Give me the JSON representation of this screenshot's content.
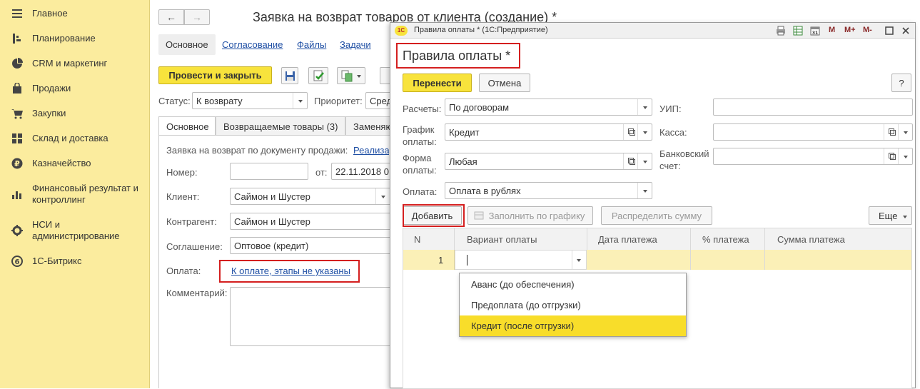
{
  "sidebar": {
    "items": [
      {
        "label": "Главное",
        "icon": "menu-icon"
      },
      {
        "label": "Планирование",
        "icon": "planning-icon"
      },
      {
        "label": "CRM и маркетинг",
        "icon": "crm-icon"
      },
      {
        "label": "Продажи",
        "icon": "bag-icon"
      },
      {
        "label": "Закупки",
        "icon": "cart-icon"
      },
      {
        "label": "Склад и доставка",
        "icon": "warehouse-icon"
      },
      {
        "label": "Казначейство",
        "icon": "ruble-icon"
      },
      {
        "label": "Финансовый результат и контроллинг",
        "icon": "bar-chart-icon"
      },
      {
        "label": "НСИ и администрирование",
        "icon": "gear-icon"
      },
      {
        "label": "1С-Битрикс",
        "icon": "bitrix-icon"
      }
    ]
  },
  "main": {
    "title": "Заявка на возврат товаров от клиента (создание) *",
    "tabs": [
      "Основное",
      "Согласование",
      "Файлы",
      "Задачи"
    ],
    "post_close_label": "Провести и закрыть",
    "status_label": "Статус:",
    "status_value": "К возврату",
    "priority_label": "Приоритет:",
    "priority_value": "Сред",
    "inner_tabs": [
      "Основное",
      "Возвращаемые товары (3)",
      "Заменяю"
    ],
    "sale_doc_label": "Заявка на возврат по документу продажи:",
    "sale_doc_link": "Реализа",
    "number_label": "Номер:",
    "number_value": "",
    "date_label": "от:",
    "date_value": "22.11.2018  0",
    "client_label": "Клиент:",
    "client_value": "Саймон и Шустер",
    "contractor_label": "Контрагент:",
    "contractor_value": "Саймон и Шустер",
    "agreement_label": "Соглашение:",
    "agreement_value": "Оптовое (кредит)",
    "payment_label": "Оплата:",
    "payment_link": "К оплате, этапы не указаны",
    "comment_label": "Комментарий:",
    "comment_value": ""
  },
  "dialog": {
    "window_title": "Правила оплаты * (1С:Предприятие)",
    "logo_text": "1С",
    "toolbar_icons": [
      "print-icon",
      "table-icon",
      "calendar-icon",
      "memory-m-icon",
      "memory-m-plus-icon",
      "memory-m-minus-icon",
      "maximize-icon",
      "close-icon"
    ],
    "toolbar_text": [
      "M",
      "M+",
      "M-"
    ],
    "heading": "Правила оплаты *",
    "transfer_label": "Перенести",
    "cancel_label": "Отмена",
    "help_label": "?",
    "settlements_label": "Расчеты:",
    "settlements_value": "По договорам",
    "uip_label": "УИП:",
    "uip_value": "",
    "schedule_label_1": "График",
    "schedule_label_2": "оплаты:",
    "schedule_value": "Кредит",
    "cashbox_label": "Касса:",
    "cashbox_value": "",
    "form_label_1": "Форма",
    "form_label_2": "оплаты:",
    "form_value": "Любая",
    "bank_label_1": "Банковский",
    "bank_label_2": "счет:",
    "bank_value": "",
    "payment_label": "Оплата:",
    "payment_value": "Оплата в рублях",
    "add_label": "Добавить",
    "fill_label": "Заполнить по графику",
    "distribute_label": "Распределить сумму",
    "more_label": "Еще",
    "columns": [
      "N",
      "Вариант оплаты",
      "Дата платежа",
      "% платежа",
      "Сумма платежа"
    ],
    "row_number": "1",
    "dropdown_options": [
      "Аванс (до обеспечения)",
      "Предоплата (до отгрузки)",
      "Кредит (после отгрузки)"
    ],
    "dropdown_selected": "Кредит (после отгрузки)"
  },
  "colors": {
    "sidebar_bg": "#fbec9e",
    "accent_yellow": "#f8e33c",
    "highlight_red": "#d41f1f",
    "link_blue": "#1f4fa4",
    "row_yellow": "#fbf0b7"
  }
}
